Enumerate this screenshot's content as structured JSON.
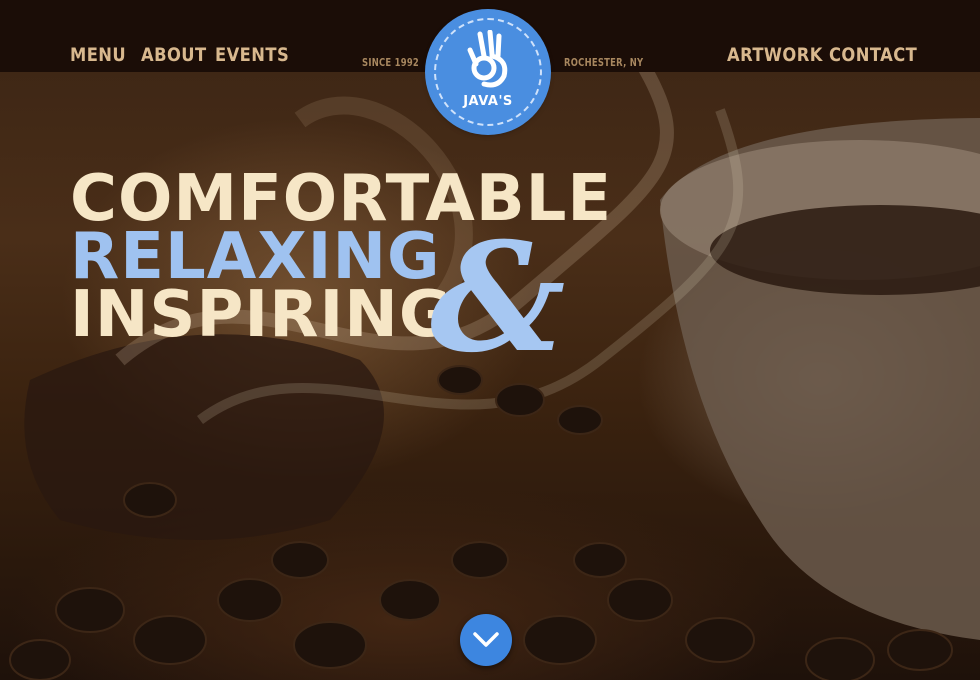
{
  "nav": {
    "left": [
      {
        "label": "MENU"
      },
      {
        "label": "ABOUT"
      },
      {
        "label": "EVENTS"
      }
    ],
    "right": [
      {
        "label": "ARTWORK"
      },
      {
        "label": "CONTACT"
      }
    ]
  },
  "meta": {
    "since": "SINCE 1992",
    "location": "ROCHESTER, NY"
  },
  "logo": {
    "name": "JAVA'S",
    "icon": "ok-hand-icon"
  },
  "hero": {
    "line1": "COMFORTABLE",
    "line2": "RELAXING",
    "line3": "INSPIRING",
    "ampersand": "&"
  },
  "scroll": {
    "icon": "chevron-down-icon"
  },
  "colors": {
    "accent_blue": "#4a8ee0",
    "nav_tan": "#d8b88e",
    "headline_cream": "#f6e6c6",
    "headline_blue": "#9fc2f0"
  }
}
